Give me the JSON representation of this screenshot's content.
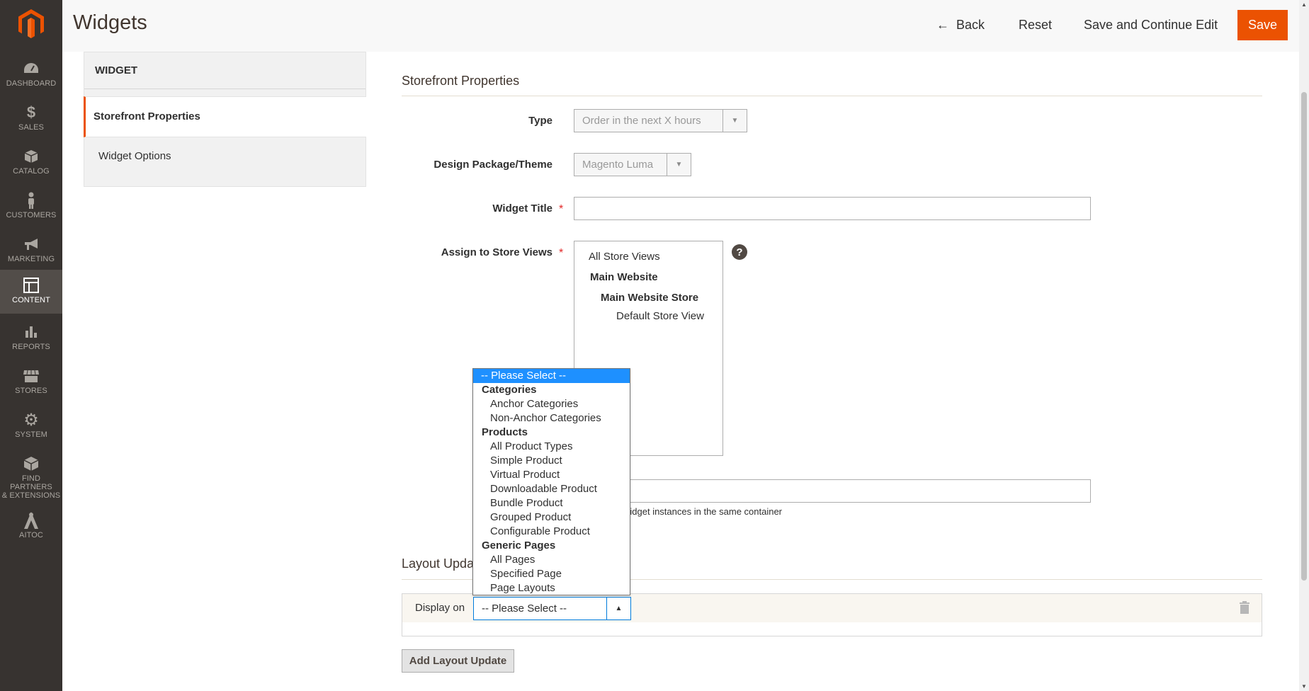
{
  "header": {
    "title": "Widgets",
    "back_label": "Back",
    "reset_label": "Reset",
    "save_continue_label": "Save and Continue Edit",
    "save_label": "Save"
  },
  "sidebar": {
    "items": [
      {
        "label": "DASHBOARD",
        "icon": "dashboard-icon"
      },
      {
        "label": "SALES",
        "icon": "dollar-icon"
      },
      {
        "label": "CATALOG",
        "icon": "box-icon"
      },
      {
        "label": "CUSTOMERS",
        "icon": "person-icon"
      },
      {
        "label": "MARKETING",
        "icon": "megaphone-icon"
      },
      {
        "label": "CONTENT",
        "icon": "layout-icon"
      },
      {
        "label": "REPORTS",
        "icon": "bar-chart-icon"
      },
      {
        "label": "STORES",
        "icon": "storefront-icon"
      },
      {
        "label": "SYSTEM",
        "icon": "gear-icon"
      },
      {
        "label": "FIND PARTNERS",
        "label2": "& EXTENSIONS",
        "icon": "cube-icon"
      },
      {
        "label": "AITOC",
        "icon": "aitoc-icon"
      }
    ]
  },
  "tabs": {
    "heading": "WIDGET",
    "active": "Storefront Properties",
    "other": "Widget Options"
  },
  "form": {
    "section_title": "Storefront Properties",
    "type_label": "Type",
    "type_value": "Order in the next X hours",
    "theme_label": "Design Package/Theme",
    "theme_value": "Magento Luma",
    "title_label": "Widget Title",
    "title_value": "",
    "store_views_label": "Assign to Store Views",
    "store_views": {
      "all": "All Store Views",
      "website": "Main Website",
      "store": "Main Website Store",
      "view": "Default Store View"
    },
    "help_glyph": "?",
    "note_text": "widget instances in the same container"
  },
  "layout_updates": {
    "title": "Layout Upda",
    "display_on_label": "Display on",
    "display_on_value": "-- Please Select --",
    "add_button": "Add Layout Update"
  },
  "dropdown": {
    "options": [
      {
        "label": "-- Please Select --",
        "kind": "selected"
      },
      {
        "label": "Categories",
        "kind": "group"
      },
      {
        "label": "Anchor Categories",
        "kind": "option"
      },
      {
        "label": "Non-Anchor Categories",
        "kind": "option"
      },
      {
        "label": "Products",
        "kind": "group"
      },
      {
        "label": "All Product Types",
        "kind": "option"
      },
      {
        "label": "Simple Product",
        "kind": "option"
      },
      {
        "label": "Virtual Product",
        "kind": "option"
      },
      {
        "label": "Downloadable Product",
        "kind": "option"
      },
      {
        "label": "Bundle Product",
        "kind": "option"
      },
      {
        "label": "Grouped Product",
        "kind": "option"
      },
      {
        "label": "Configurable Product",
        "kind": "option"
      },
      {
        "label": "Generic Pages",
        "kind": "group"
      },
      {
        "label": "All Pages",
        "kind": "option"
      },
      {
        "label": "Specified Page",
        "kind": "option"
      },
      {
        "label": "Page Layouts",
        "kind": "option"
      }
    ]
  },
  "colors": {
    "accent": "#eb5202",
    "sidebar_bg": "#373330",
    "sidebar_active": "#524d49",
    "required": "#e22626",
    "selection": "#1e90ff"
  }
}
